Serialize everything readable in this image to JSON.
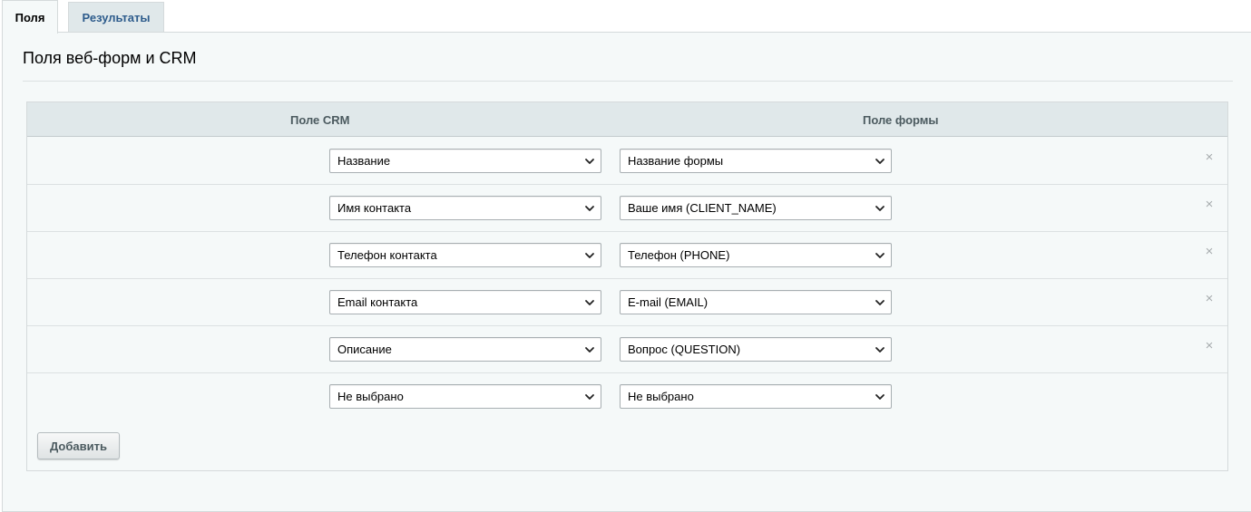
{
  "tabs": [
    {
      "label": "Поля",
      "active": true
    },
    {
      "label": "Результаты",
      "active": false
    }
  ],
  "page_title": "Поля веб-форм и CRM",
  "table": {
    "columns": [
      "Поле CRM",
      "Поле формы"
    ],
    "rows": [
      {
        "crm": "Название",
        "form": "Название формы",
        "removable": true
      },
      {
        "crm": "Имя контакта",
        "form": "Ваше имя (CLIENT_NAME)",
        "removable": true
      },
      {
        "crm": "Телефон контакта",
        "form": "Телефон (PHONE)",
        "removable": true
      },
      {
        "crm": "Email контакта",
        "form": "E-mail (EMAIL)",
        "removable": true
      },
      {
        "crm": "Описание",
        "form": "Вопрос (QUESTION)",
        "removable": true
      },
      {
        "crm": "Не выбрано",
        "form": "Не выбрано",
        "removable": false
      }
    ],
    "remove_glyph": "×"
  },
  "add_button": "Добавить",
  "icons": {
    "select": "chevron-down-icon",
    "remove": "close-icon"
  },
  "colors": {
    "panel_bg": "#f5f9f9",
    "header_bg": "#e0e8ea",
    "active_tab_text": "#000000",
    "inactive_tab_text": "#2e5c8c",
    "remove_icon": "#a7acae"
  }
}
